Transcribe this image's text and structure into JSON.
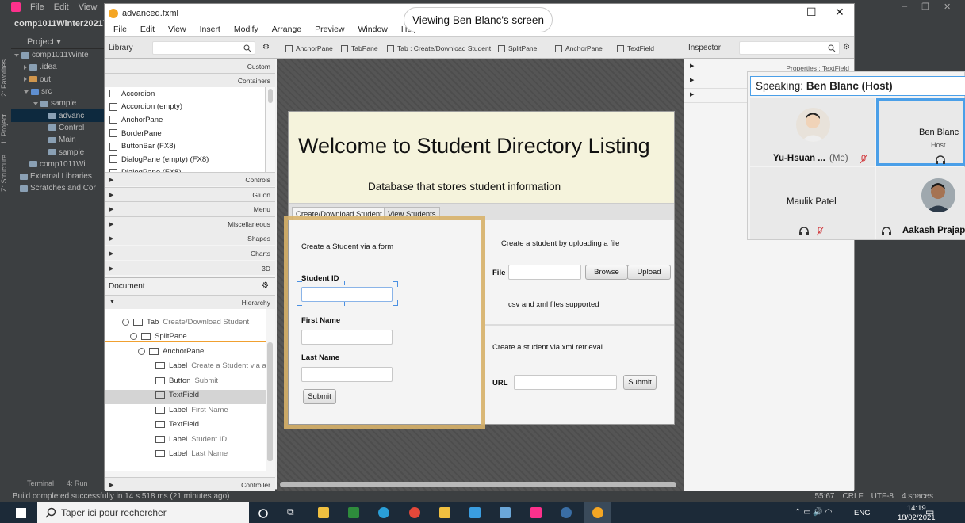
{
  "ide": {
    "menu": [
      "File",
      "Edit",
      "View",
      "Na"
    ],
    "project_title": "comp1011Winter2021Th",
    "project_header": "Project",
    "side_tabs": [
      "2: Favorites",
      "1: Project",
      "Z: Structure"
    ],
    "tree": [
      {
        "label": "comp1011Winte",
        "indent": 0,
        "expanded": true,
        "icon": "folder"
      },
      {
        "label": ".idea",
        "indent": 1,
        "expanded": false,
        "icon": "folder"
      },
      {
        "label": "out",
        "indent": 1,
        "expanded": false,
        "icon": "folder-orange"
      },
      {
        "label": "src",
        "indent": 1,
        "expanded": true,
        "icon": "folder-blue"
      },
      {
        "label": "sample",
        "indent": 2,
        "expanded": true,
        "icon": "folder"
      },
      {
        "label": "advanc",
        "indent": 3,
        "selected": true,
        "icon": "fxml-file"
      },
      {
        "label": "Control",
        "indent": 3,
        "icon": "class-file"
      },
      {
        "label": "Main",
        "indent": 3,
        "icon": "class-file"
      },
      {
        "label": "sample",
        "indent": 3,
        "icon": "css-file"
      },
      {
        "label": "comp1011Wi",
        "indent": 1,
        "icon": "file"
      },
      {
        "label": "External Libraries",
        "indent": 0,
        "icon": "library"
      },
      {
        "label": "Scratches and Cor",
        "indent": 0,
        "icon": "scratch"
      }
    ],
    "bottom_tabs": [
      "Terminal",
      "4: Run"
    ],
    "status_text": "Build completed successfully in 14 s 518 ms (21 minutes ago)",
    "status_right": [
      "55:67",
      "CRLF",
      "UTF-8",
      "4 spaces"
    ]
  },
  "scenebuilder": {
    "title": "advanced.fxml",
    "menu": [
      "File",
      "Edit",
      "View",
      "Insert",
      "Modify",
      "Arrange",
      "Preview",
      "Window",
      "Help"
    ],
    "library_label": "Library",
    "inspector_label": "Inspector",
    "breadcrumbs": [
      "AnchorPane",
      "TabPane",
      "Tab : Create/Download Student",
      "SplitPane",
      "AnchorPane",
      "TextField :"
    ],
    "library_sections_top": [
      "Custom",
      "Containers"
    ],
    "library_items": [
      "Accordion",
      "Accordion  (empty)",
      "AnchorPane",
      "BorderPane",
      "ButtonBar  (FX8)",
      "DialogPane (empty)  (FX8)",
      "DialogPane  (FX8)"
    ],
    "library_sections_bottom": [
      "Controls",
      "Gluon",
      "Menu",
      "Miscellaneous",
      "Shapes",
      "Charts",
      "3D"
    ],
    "document_label": "Document",
    "hierarchy_label": "Hierarchy",
    "controller_label": "Controller",
    "hierarchy": [
      {
        "type": "Tab",
        "name": "Create/Download Student"
      },
      {
        "type": "SplitPane",
        "name": ""
      },
      {
        "type": "AnchorPane",
        "name": ""
      },
      {
        "type": "Label",
        "name": "Create a Student via a"
      },
      {
        "type": "Button",
        "name": "Submit"
      },
      {
        "type": "TextField",
        "name": ""
      },
      {
        "type": "Label",
        "name": "First Name"
      },
      {
        "type": "TextField",
        "name": ""
      },
      {
        "type": "Label",
        "name": "Student ID"
      },
      {
        "type": "Label",
        "name": "Last Name"
      }
    ],
    "inspector_properties": "Properties : TextField"
  },
  "stage": {
    "heading": "Welcome to Student Directory Listing",
    "subheading": "Database that stores student information",
    "tabs": [
      "Create/Download Student",
      "View Students"
    ],
    "left": {
      "intro": "Create a Student via a form",
      "student_id_label": "Student ID",
      "first_name_label": "First Name",
      "last_name_label": "Last Name",
      "submit_label": "Submit"
    },
    "right": {
      "upload_intro": "Create a student by uploading a file",
      "file_label": "File",
      "browse_label": "Browse",
      "upload_label": "Upload",
      "supported": "csv and xml files supported",
      "xml_intro": "Create a student via xml retrieval",
      "url_label": "URL",
      "submit_label": "Submit"
    }
  },
  "teams": {
    "viewing": "Viewing Ben Blanc's screen",
    "speaking_prefix": "Speaking:",
    "speaking_name": "Ben Blanc (Host)",
    "participants": [
      {
        "name": "Yu-Hsuan ...",
        "suffix": "(Me)",
        "muted": true
      },
      {
        "name": "Ben Blanc",
        "role": "Host",
        "speaking": true
      },
      {
        "name": "Maulik Patel",
        "muted": true
      },
      {
        "name": "Aakash Prajapa"
      }
    ]
  },
  "taskbar": {
    "search_placeholder": "Taper ici pour rechercher",
    "lang": "ENG",
    "time": "14:19",
    "date": "18/02/2021"
  },
  "colors": {
    "selection_gold": "#d8b26a",
    "speaking_blue": "#4a9fe8",
    "muted_red": "#d13438",
    "banner_bg": "#f5f3dc"
  }
}
